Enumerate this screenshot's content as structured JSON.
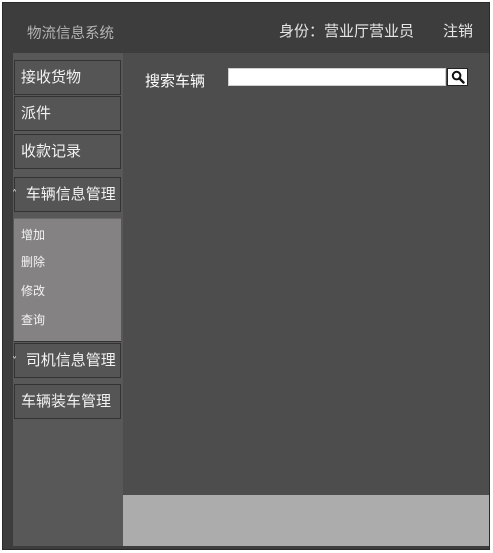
{
  "header": {
    "app_title": "物流信息系统",
    "identity": "身份：营业厅营业员",
    "logout": "注销"
  },
  "sidebar": {
    "items": [
      {
        "label": "接收货物"
      },
      {
        "label": "派件"
      },
      {
        "label": "收款记录"
      },
      {
        "label": "车辆信息管理",
        "expanded": true
      },
      {
        "label": "司机信息管理",
        "expanded": false
      },
      {
        "label": "车辆装车管理"
      }
    ],
    "submenu": [
      "增加",
      "删除",
      "修改",
      "查询"
    ]
  },
  "main": {
    "search_label": "搜索车辆",
    "search_value": "",
    "search_icon": "search-icon"
  },
  "colors": {
    "window_bg": "#3d3d3d",
    "sidebar_item_bg": "#555555",
    "submenu_bg": "#848282",
    "main_bg": "#4d4d4d",
    "footer_bg": "#acacac"
  }
}
